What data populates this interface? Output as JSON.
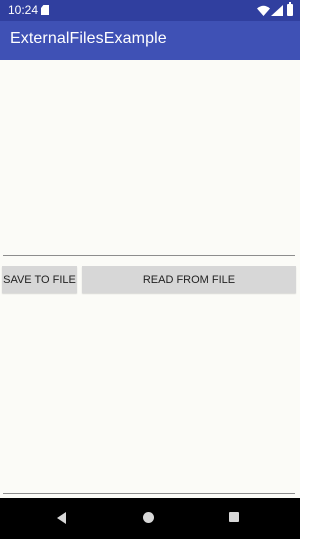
{
  "status_bar": {
    "time": "10:24",
    "icons": [
      "sd-card-icon",
      "wifi-icon",
      "signal-icon",
      "battery-icon"
    ]
  },
  "app_bar": {
    "title": "ExternalFilesExample",
    "status_color": "#303f9f",
    "color": "#3f51b5"
  },
  "buttons": {
    "save_label": "SAVE TO FILE",
    "read_label": "READ FROM FILE"
  },
  "nav_bar": {
    "icons": [
      "back-icon",
      "home-icon",
      "recents-icon"
    ]
  }
}
